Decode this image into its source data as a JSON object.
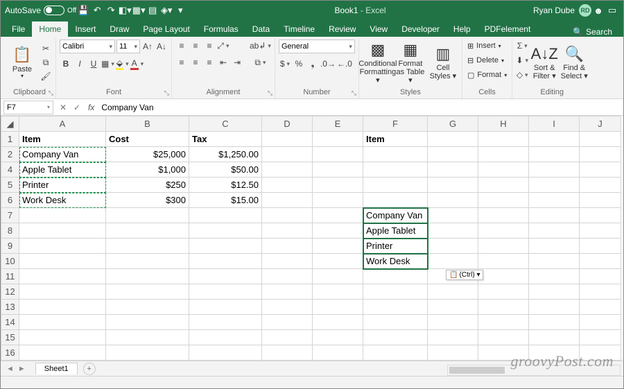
{
  "title": {
    "autosave": "AutoSave",
    "autosave_state": "Off",
    "doc": "Book1",
    "app": "Excel",
    "user": "Ryan Dube",
    "initials": "RD"
  },
  "tabs": {
    "file": "File",
    "home": "Home",
    "insert": "Insert",
    "draw": "Draw",
    "page": "Page Layout",
    "formulas": "Formulas",
    "data": "Data",
    "timeline": "Timeline",
    "review": "Review",
    "view": "View",
    "developer": "Developer",
    "help": "Help",
    "pdf": "PDFelement",
    "search": "Search"
  },
  "ribbon": {
    "clipboard": {
      "paste": "Paste",
      "label": "Clipboard"
    },
    "font": {
      "name": "Calibri",
      "size": "11",
      "bold": "B",
      "italic": "I",
      "underline": "U",
      "fontcolor": "A",
      "fill": "◧",
      "inc": "A▴",
      "dec": "A▾",
      "label": "Font"
    },
    "alignment": {
      "wrap": "Wrap",
      "merge": "Merge",
      "label": "Alignment"
    },
    "number": {
      "format": "General",
      "currency": "$",
      "percent": "%",
      "comma": ",",
      "inc": "◀.0",
      "dec": ".0▶",
      "label": "Number"
    },
    "styles": {
      "cf": "Conditional Formatting ▾",
      "fat": "Format as Table ▾",
      "cs": "Cell Styles ▾",
      "label": "Styles"
    },
    "cells": {
      "insert": "Insert",
      "delete": "Delete",
      "format": "Format",
      "label": "Cells"
    },
    "editing": {
      "sort": "Sort & Filter ▾",
      "find": "Find & Select ▾",
      "sum": "Σ",
      "fill": "▾",
      "clear": "◇",
      "label": "Editing"
    }
  },
  "formula_bar": {
    "ref": "F7",
    "fx": "fx",
    "value": "Company Van"
  },
  "columns": [
    "A",
    "B",
    "C",
    "D",
    "E",
    "F",
    "G",
    "H",
    "I",
    "J"
  ],
  "rows": [
    "1",
    "2",
    "4",
    "5",
    "6",
    "7",
    "8",
    "9",
    "10",
    "11",
    "12",
    "13",
    "14",
    "15",
    "16"
  ],
  "data": {
    "A1": "Item",
    "B1": "Cost",
    "C1": "Tax",
    "F1": "Item",
    "A2": "Company Van",
    "B2": "$25,000",
    "C2": "$1,250.00",
    "A4": "Apple Tablet",
    "B4": "$1,000",
    "C4": "$50.00",
    "A5": "Printer",
    "B5": "$250",
    "C5": "$12.50",
    "A6": "Work Desk",
    "B6": "$300",
    "C6": "$15.00",
    "F7": "Company Van",
    "F8": "Apple Tablet",
    "F9": "Printer",
    "F10": "Work Desk"
  },
  "paste_tag": "(Ctrl) ▾",
  "sheet": {
    "name": "Sheet1"
  },
  "watermark": "groovyPost.com"
}
